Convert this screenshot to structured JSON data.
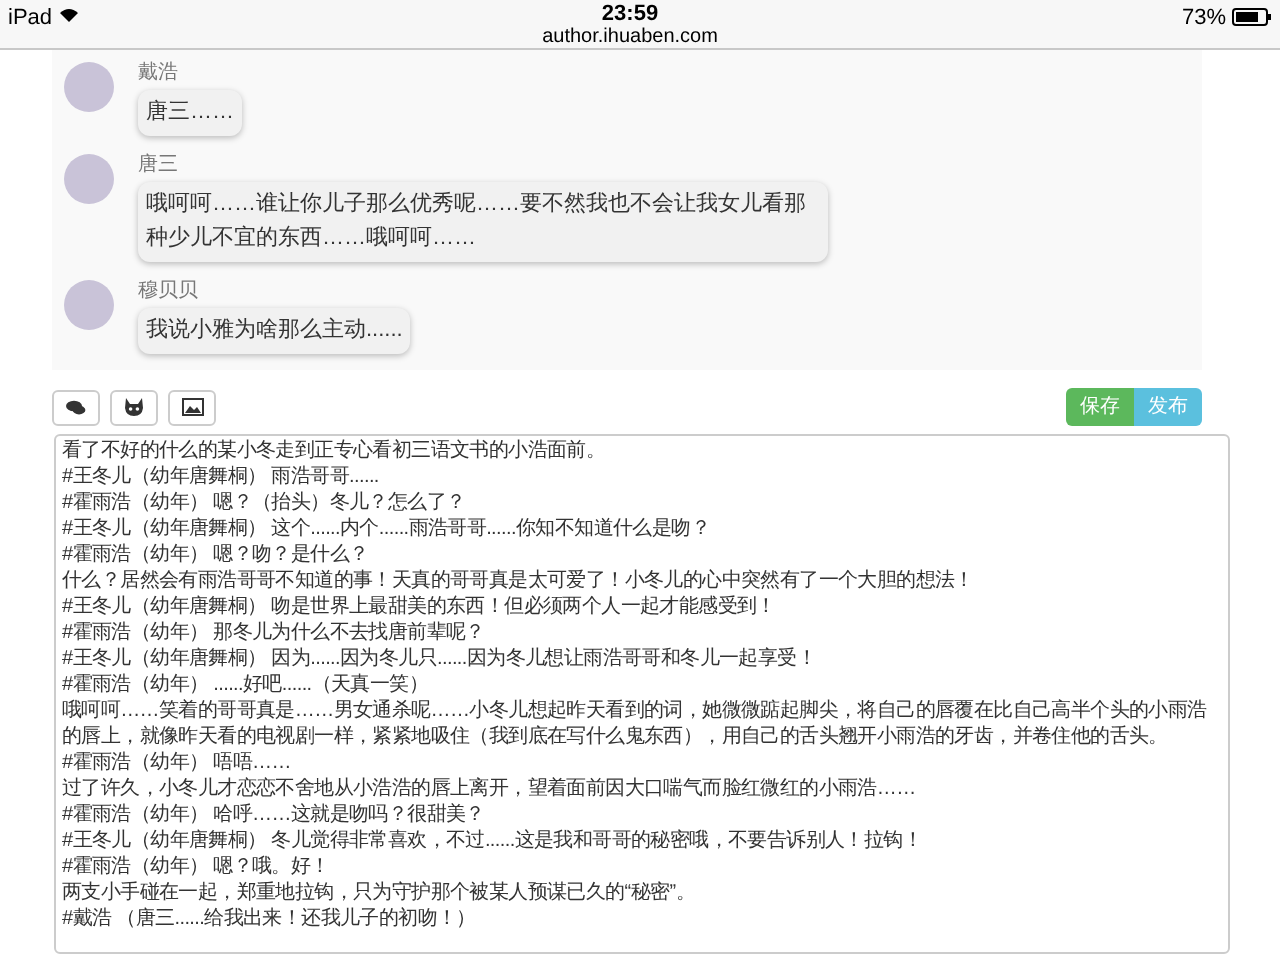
{
  "status_bar": {
    "device": "iPad",
    "time": "23:59",
    "url": "author.ihuaben.com",
    "battery": "73%"
  },
  "messages": [
    {
      "name": "戴浩",
      "text": "唐三……"
    },
    {
      "name": "唐三",
      "text": "哦呵呵……谁让你儿子那么优秀呢……要不然我也不会让我女儿看那种少儿不宜的东西……哦呵呵……"
    },
    {
      "name": "穆贝贝",
      "text": "我说小雅为啥那么主动......"
    }
  ],
  "toolbar": {
    "buttons": [
      {
        "kind": "chat"
      },
      {
        "kind": "cat"
      },
      {
        "kind": "image"
      }
    ],
    "save": "保存",
    "publish": "发布"
  },
  "editor": {
    "lines": [
      "看了不好的什么的某小冬走到正专心看初三语文书的小浩面前。",
      "#王冬儿（幼年唐舞桐） 雨浩哥哥......",
      "#霍雨浩（幼年） 嗯？（抬头）冬儿？怎么了？",
      "#王冬儿（幼年唐舞桐） 这个......内个......雨浩哥哥......你知不知道什么是吻？",
      "#霍雨浩（幼年） 嗯？吻？是什么？",
      "什么？居然会有雨浩哥哥不知道的事！天真的哥哥真是太可爱了！小冬儿的心中突然有了一个大胆的想法！",
      "#王冬儿（幼年唐舞桐） 吻是世界上最甜美的东西！但必须两个人一起才能感受到！",
      "#霍雨浩（幼年） 那冬儿为什么不去找唐前辈呢？",
      "#王冬儿（幼年唐舞桐） 因为......因为冬儿只......因为冬儿想让雨浩哥哥和冬儿一起享受！",
      "#霍雨浩（幼年） ......好吧......（天真一笑）",
      "哦呵呵……笑着的哥哥真是……男女通杀呢……小冬儿想起昨天看到的词，她微微踮起脚尖，将自己的唇覆在比自己高半个头的小雨浩的唇上，就像昨天看的电视剧一样，紧紧地吸住（我到底在写什么鬼东西），用自己的舌头翘开小雨浩的牙齿，并卷住他的舌头。",
      "#霍雨浩（幼年） 唔唔……",
      "过了许久，小冬儿才恋恋不舍地从小浩浩的唇上离开，望着面前因大口喘气而脸红微红的小雨浩……",
      "#霍雨浩（幼年） 哈呼……这就是吻吗？很甜美？",
      "#王冬儿（幼年唐舞桐） 冬儿觉得非常喜欢，不过......这是我和哥哥的秘密哦，不要告诉别人！拉钩！",
      "#霍雨浩（幼年） 嗯？哦。好！",
      "两支小手碰在一起，郑重地拉钩，只为守护那个被某人预谋已久的“秘密”。",
      "#戴浩 （唐三......给我出来！还我儿子的初吻！）"
    ]
  }
}
